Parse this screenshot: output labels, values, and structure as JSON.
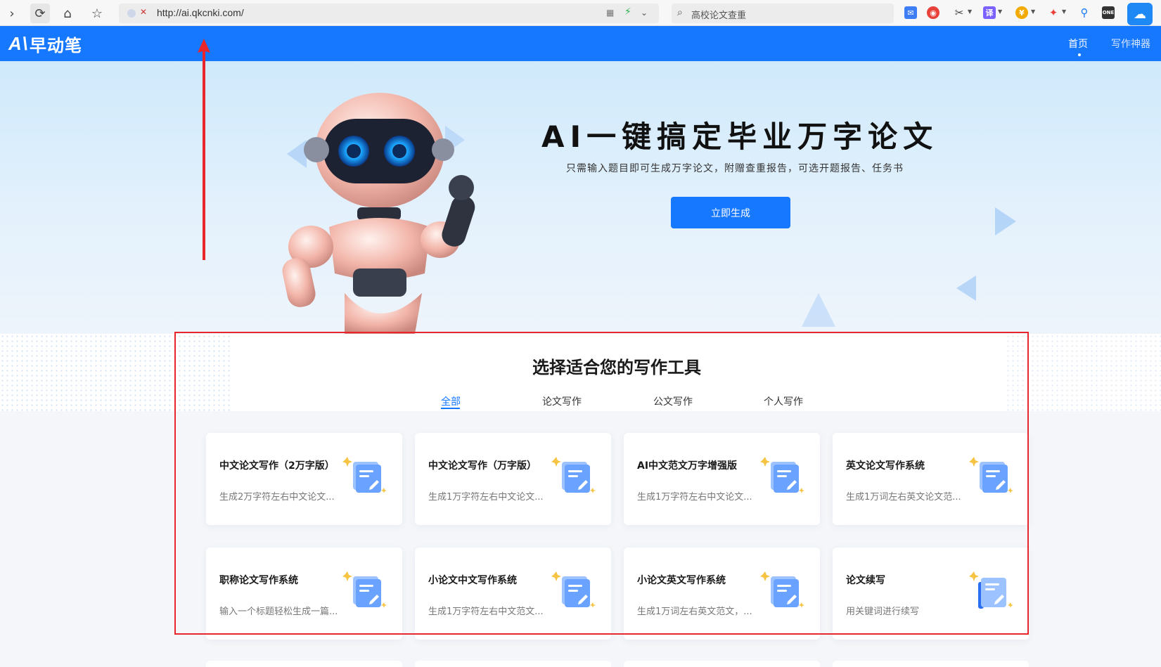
{
  "browser": {
    "url": "http://ai.qkcnki.com/",
    "search_text": "高校论文查重",
    "ext_translate": "译",
    "ext_app": "ONE"
  },
  "header": {
    "logo_text": "早动笔",
    "logo_mark": "A\\",
    "nav": [
      "首页",
      "写作神器"
    ],
    "brand_color": "#1677ff"
  },
  "hero": {
    "title": "AI一键搞定毕业万字论文",
    "subtitle": "只需输入题目即可生成万字论文，附赠查重报告，可选开题报告、任务书",
    "button": "立即生成"
  },
  "tools": {
    "title": "选择适合您的写作工具",
    "tabs": [
      "全部",
      "论文写作",
      "公文写作",
      "个人写作"
    ],
    "active_tab": 0,
    "cards": [
      {
        "title": "中文论文写作（2万字版）",
        "desc": "生成2万字符左右中文论文..."
      },
      {
        "title": "中文论文写作（万字版）",
        "desc": "生成1万字符左右中文论文..."
      },
      {
        "title": "AI中文范文万字增强版",
        "desc": "生成1万字符左右中文论文..."
      },
      {
        "title": "英文论文写作系统",
        "desc": "生成1万词左右英文论文范..."
      },
      {
        "title": "职称论文写作系统",
        "desc": "输入一个标题轻松生成一篇..."
      },
      {
        "title": "小论文中文写作系统",
        "desc": "生成1万字符左右中文范文..."
      },
      {
        "title": "小论文英文写作系统",
        "desc": "生成1万词左右英文范文，..."
      },
      {
        "title": "论文续写",
        "desc": "用关键词进行续写"
      }
    ]
  },
  "annotation_color": "#e8262c"
}
